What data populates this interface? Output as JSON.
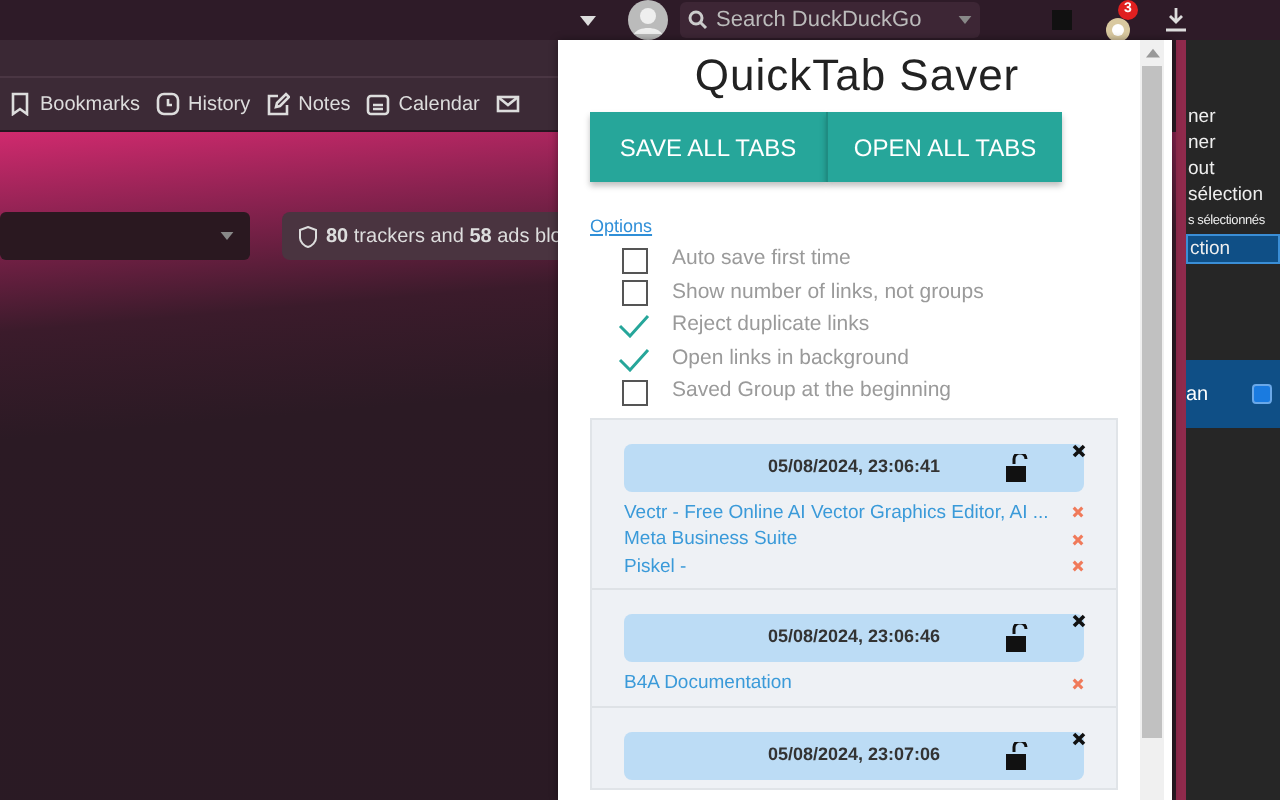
{
  "toolbar": {
    "search_placeholder": "Search DuckDuckGo",
    "badge": "3"
  },
  "bookmarks_bar": [
    {
      "kind": "bookmark",
      "label": "Bookmarks"
    },
    {
      "kind": "history",
      "label": "History"
    },
    {
      "kind": "notes",
      "label": "Notes"
    },
    {
      "kind": "calendar",
      "label": "Calendar"
    },
    {
      "kind": "mail"
    }
  ],
  "page": {
    "tracker_text": "**80** trackers and **58** ads blo"
  },
  "side_panel": {
    "items": [
      {
        "label": "ner",
        "selected": false
      },
      {
        "label": "ner",
        "selected": false
      },
      {
        "label": "out",
        "selected": false
      },
      {
        "label": "sélection",
        "selected": false
      },
      {
        "label": "s sélectionnés",
        "selected": false
      },
      {
        "label": "ction",
        "selected": true
      }
    ],
    "row": {
      "label": "an",
      "checked": true
    }
  },
  "popup": {
    "title": "QuickTab Saver",
    "buttons": [
      "SAVE ALL TABS",
      "OPEN ALL TABS"
    ],
    "options_link": "Options",
    "options": [
      {
        "label": "Auto save first time",
        "checked": false
      },
      {
        "label": "Show number of links, not groups",
        "checked": false
      },
      {
        "label": "Reject duplicate links",
        "checked": true
      },
      {
        "label": "Open links in background",
        "checked": true
      },
      {
        "label": "Saved Group at the beginning",
        "checked": false
      }
    ],
    "groups": [
      {
        "time": "05/08/2024, 23:06:41",
        "locked": false,
        "links": [
          "Vectr - Free Online AI Vector Graphics Editor, AI ...",
          "Meta Business Suite",
          "Piskel -"
        ]
      },
      {
        "time": "05/08/2024, 23:06:46",
        "locked": false,
        "links": [
          "B4A Documentation"
        ]
      },
      {
        "time": "05/08/2024, 23:07:06",
        "locked": false
      }
    ]
  }
}
